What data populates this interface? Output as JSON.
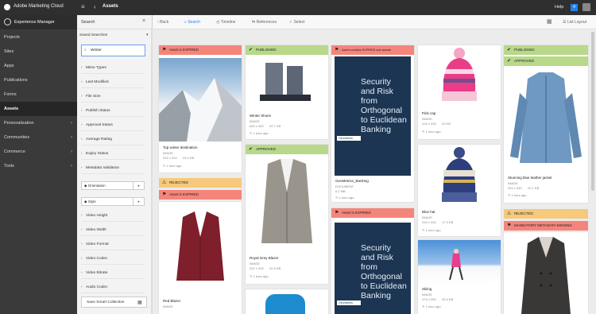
{
  "topbar": {
    "brand": "Adobe Marketing Cloud",
    "section": "Assets",
    "help": "Help",
    "notifications": "4",
    "menu_icon": "menu-icon",
    "back_icon": "chevron-left-icon"
  },
  "nav": {
    "header": "Experience Manager",
    "items": [
      {
        "label": "Projects",
        "chev": ""
      },
      {
        "label": "Sites",
        "chev": ""
      },
      {
        "label": "Apps",
        "chev": ""
      },
      {
        "label": "Publications",
        "chev": ""
      },
      {
        "label": "Forms",
        "chev": ""
      },
      {
        "label": "Assets",
        "chev": ""
      },
      {
        "label": "Personalization",
        "chev": "›"
      },
      {
        "label": "Communities",
        "chev": "›"
      },
      {
        "label": "Commerce",
        "chev": "›"
      },
      {
        "label": "Tools",
        "chev": "›"
      }
    ]
  },
  "filters": {
    "title": "Search",
    "saved": "Saved Searches",
    "search_value": "Winter",
    "facets": [
      "Mime Types",
      "Last Modified",
      "File Size",
      "Publish Status",
      "Approval Status",
      "Average Rating",
      "Expiry Status",
      "Metadata Validation"
    ],
    "selects": [
      "Orientation",
      "Style"
    ],
    "facets2": [
      "Video Height",
      "Video Width",
      "Video Format",
      "Video Codec",
      "Video Bitrate",
      "Audio Codec"
    ],
    "save_button": "Save Smart Collection"
  },
  "toolbar": {
    "back": "Back",
    "search": "Search",
    "timeline": "Timeline",
    "references": "References",
    "select": "Select",
    "layout": "List Layout"
  },
  "cards": {
    "c1": {
      "banner": "Asset is EXPIRED",
      "title": "Top winter destination",
      "type": "IMAGE",
      "dims": "202 x 319",
      "size": "20.4 KB",
      "time": "1 hour ago"
    },
    "c1b": {
      "banner1": "REJECTED",
      "banner2": "Asset is EXPIRED"
    },
    "c1c": {
      "title": "Red Blazer",
      "type": "IMAGE"
    },
    "c2": {
      "banner": "PUBLISHED",
      "title": "Winter Shoes",
      "type": "IMAGE",
      "dims": "600 x 400",
      "size": "22.7 KB",
      "time": "1 hour ago"
    },
    "c2b": {
      "banner": "APPROVED",
      "title": "Royal Grey Blazer",
      "type": "IMAGE",
      "dims": "202 x 319",
      "size": "20.4 KB",
      "time": "1 hour ago"
    },
    "c3": {
      "banner": "Asset contains EXPIRED sub-assets",
      "doc_text": "Security and Risk from Orthogonal to Euclidean Banking",
      "tag": "Geometrics",
      "title": "GeoMetrixx_Banking",
      "type": "DOCUMENT",
      "size": "6.2 MB",
      "time": "1 hour ago"
    },
    "c3b": {
      "banner": "Asset is EXPIRED",
      "doc_text": "Security and Risk from Orthogonal to Euclidean Banking",
      "tag": "Geometrics"
    },
    "c4": {
      "title": "Pink cap",
      "type": "IMAGE",
      "dims": "416 x 416",
      "size": "20 KB",
      "time": "1 hour ago"
    },
    "c4b": {
      "title": "Blue hat",
      "type": "IMAGE",
      "dims": "416 x 416",
      "size": "17.3 KB",
      "time": "1 hour ago"
    },
    "c4c": {
      "title": "Skiing",
      "type": "IMAGE",
      "dims": "474 x 293",
      "size": "43.3 KB",
      "time": "1 hour ago"
    },
    "c5": {
      "banner1": "PUBLISHED",
      "banner2": "APPROVED",
      "title": "Stunning blue leather jacket",
      "type": "IMAGE",
      "dims": "202 x 349",
      "size": "20.7 KB",
      "time": "1 hour ago"
    },
    "c5b": {
      "banner1": "REJECTED",
      "banner2": "MANDATORY METADATA MISSING"
    }
  }
}
